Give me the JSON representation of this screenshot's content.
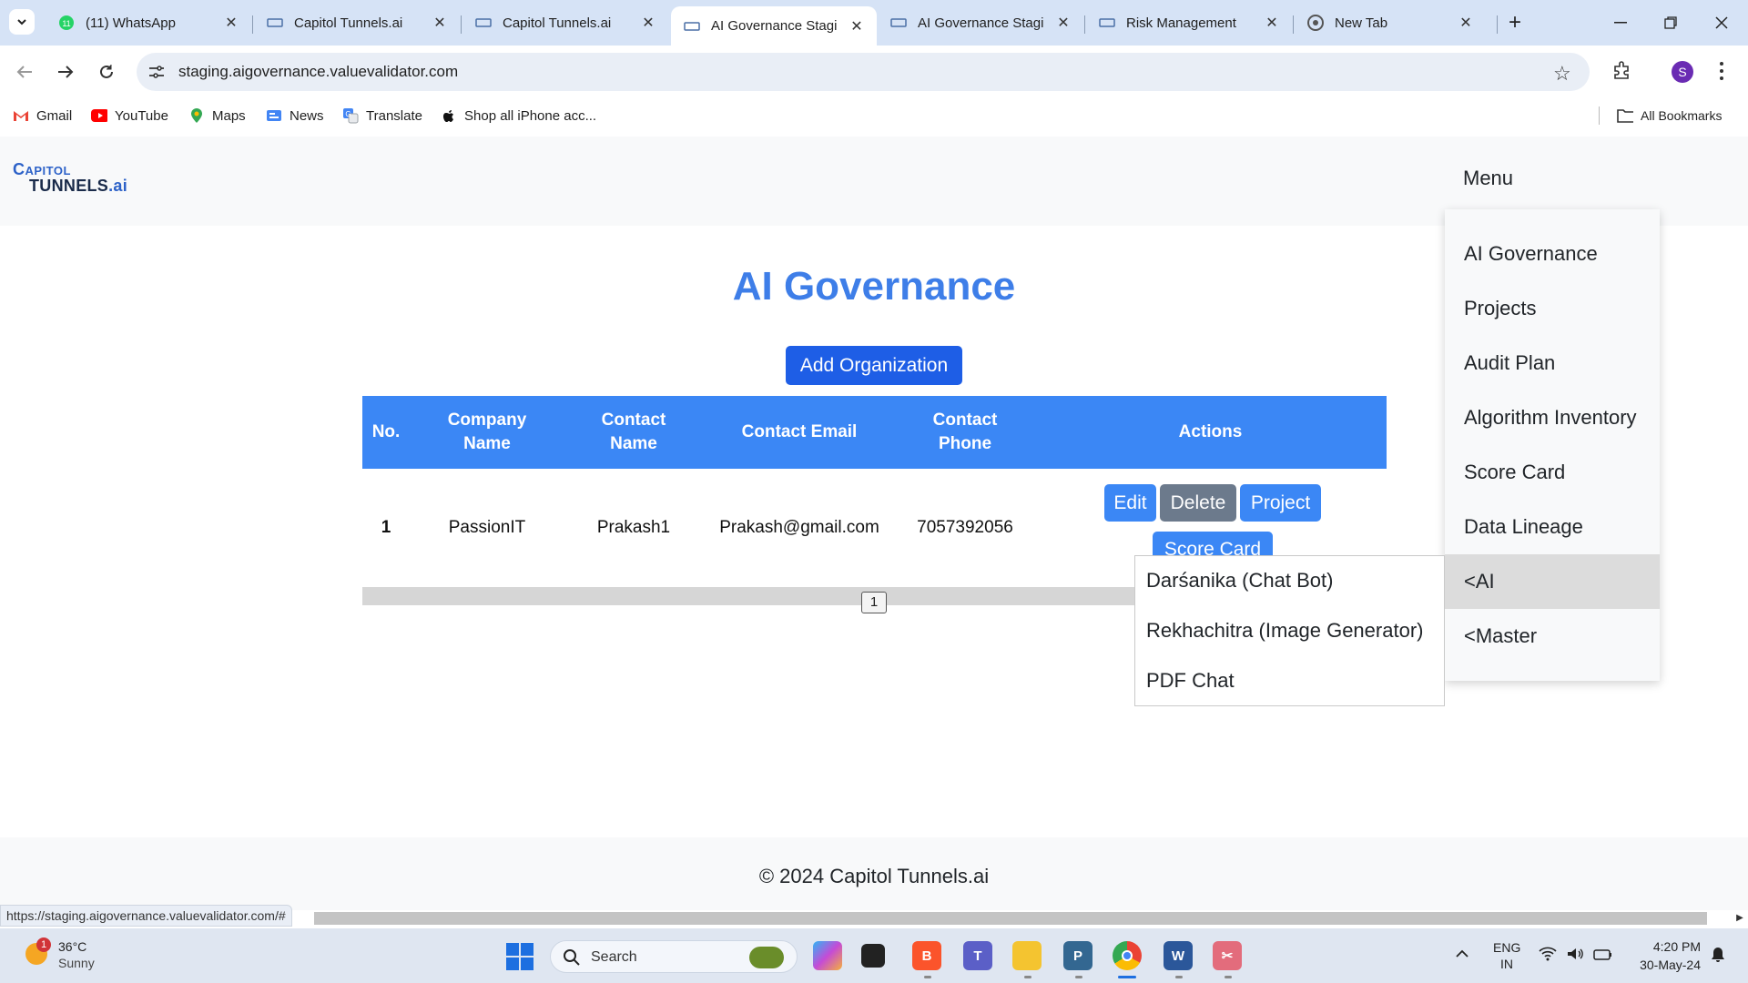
{
  "browser": {
    "tabs": [
      {
        "title": "(11) WhatsApp",
        "badge": "11"
      },
      {
        "title": "Capitol Tunnels.ai"
      },
      {
        "title": "Capitol Tunnels.ai"
      },
      {
        "title": "AI Governance Stagi"
      },
      {
        "title": "AI Governance Stagi"
      },
      {
        "title": "Risk Management"
      },
      {
        "title": "New Tab"
      }
    ],
    "url": "staging.aigovernance.valuevalidator.com",
    "profile_initial": "S",
    "bookmarks": [
      "Gmail",
      "YouTube",
      "Maps",
      "News",
      "Translate",
      "Shop all iPhone acc..."
    ],
    "all_bookmarks": "All Bookmarks",
    "status_url": "https://staging.aigovernance.valuevalidator.com/#"
  },
  "site": {
    "logo_top": "Capitol",
    "logo_bottom": "Tunnels",
    "logo_suffix": ".ai",
    "menu_label": "Menu",
    "title": "AI Governance",
    "add_button": "Add Organization",
    "table": {
      "headers": [
        "No.",
        "Company Name",
        "Contact Name",
        "Contact Email",
        "Contact Phone",
        "Actions"
      ],
      "rows": [
        {
          "no": "1",
          "company": "PassionIT",
          "contact": "Prakash1",
          "email": "Prakash@gmail.com",
          "phone": "7057392056"
        }
      ]
    },
    "actions": {
      "edit": "Edit",
      "delete": "Delete",
      "project": "Project",
      "score_card": "Score Card"
    },
    "page_number": "1",
    "menu_items": [
      "AI Governance",
      "Projects",
      "Audit Plan",
      "Algorithm Inventory",
      "Score Card",
      "Data Lineage",
      "<AI",
      "<Master"
    ],
    "submenu_items": [
      "Darśanika (Chat Bot)",
      "Rekhachitra (Image Generator)",
      "PDF Chat"
    ],
    "footer": "© 2024 Capitol Tunnels.ai"
  },
  "taskbar": {
    "weather_temp": "36°C",
    "weather_desc": "Sunny",
    "weather_badge": "1",
    "search_placeholder": "Search",
    "lang_top": "ENG",
    "lang_bottom": "IN",
    "time": "4:20 PM",
    "date": "30-May-24"
  },
  "colors": {
    "accent": "#3b87f5",
    "title": "#3e7ee8",
    "button": "#1e5ee6",
    "delete": "#6c7a8c",
    "tabstrip": "#d6e3f6"
  }
}
